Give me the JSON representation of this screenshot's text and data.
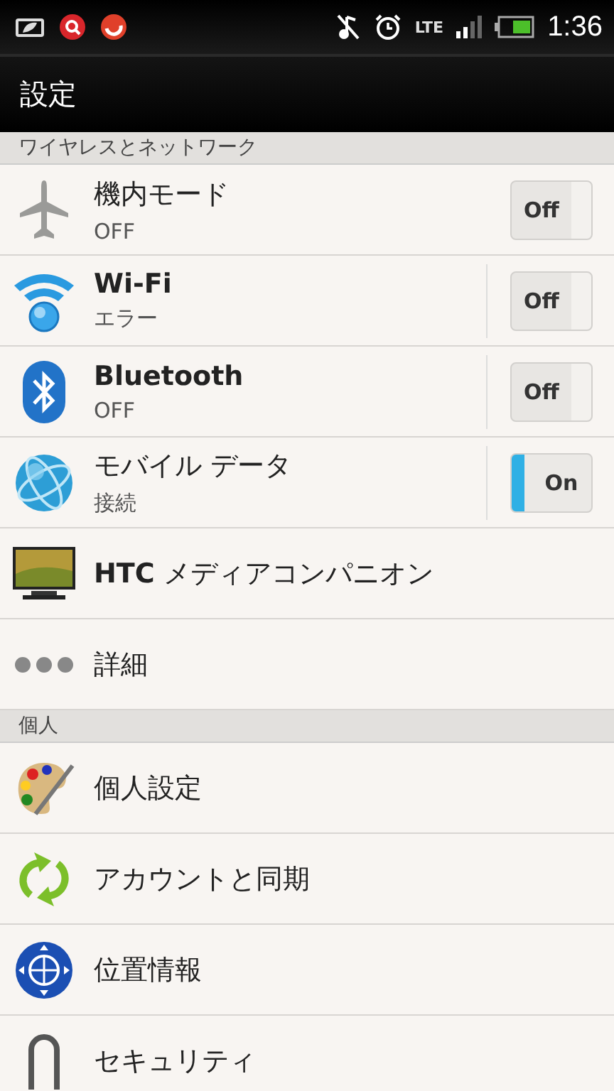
{
  "status_bar": {
    "network": "LTE",
    "time": "1:36"
  },
  "title_bar": {
    "title": "設定"
  },
  "sections": [
    {
      "header": "ワイヤレスとネットワーク",
      "items": [
        {
          "kind": "toggle",
          "title": "機内モード",
          "bold": false,
          "subtitle": "OFF",
          "split": false,
          "toggle": {
            "label": "Off",
            "on": false
          }
        },
        {
          "kind": "toggle",
          "title": "Wi-Fi",
          "bold": true,
          "subtitle": "エラー",
          "split": true,
          "toggle": {
            "label": "Off",
            "on": false
          }
        },
        {
          "kind": "toggle",
          "title": "Bluetooth",
          "bold": true,
          "subtitle": "OFF",
          "split": true,
          "toggle": {
            "label": "Off",
            "on": false
          }
        },
        {
          "kind": "toggle",
          "title": "モバイル データ",
          "bold": false,
          "subtitle": "接続",
          "split": true,
          "toggle": {
            "label": "On",
            "on": true
          }
        },
        {
          "kind": "link",
          "title": "**HTC** メディアコンパニオン",
          "bold": false
        },
        {
          "kind": "link",
          "title": "詳細",
          "bold": false
        }
      ]
    },
    {
      "header": "個人",
      "items": [
        {
          "kind": "link",
          "title": "個人設定",
          "bold": false
        },
        {
          "kind": "link",
          "title": "アカウントと同期",
          "bold": false
        },
        {
          "kind": "link",
          "title": "位置情報",
          "bold": false
        },
        {
          "kind": "link",
          "title": "セキュリティ",
          "bold": false
        }
      ]
    }
  ]
}
